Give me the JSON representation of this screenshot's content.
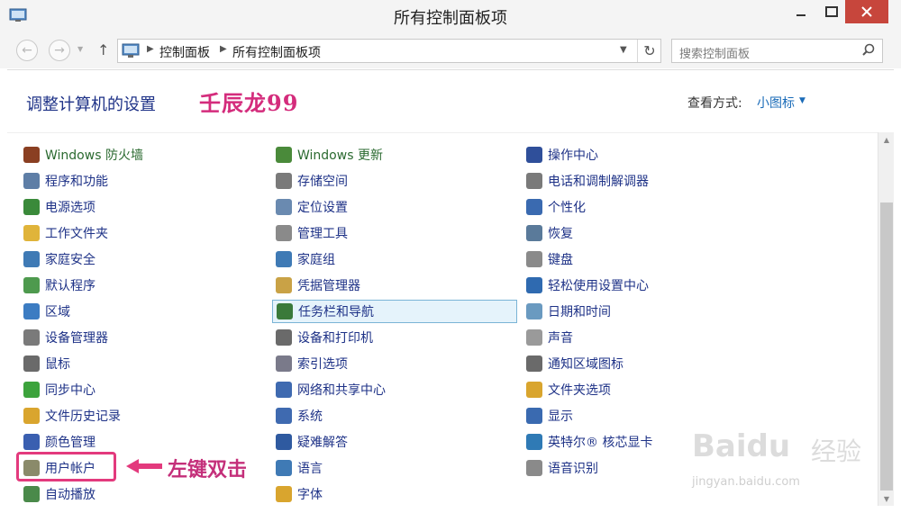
{
  "window": {
    "title": "所有控制面板项"
  },
  "address": {
    "crumbs": [
      "控制面板",
      "所有控制面板项"
    ]
  },
  "search": {
    "placeholder": "搜索控制面板"
  },
  "header": {
    "title": "调整计算机的设置",
    "watermark": "壬辰龙99",
    "view_label": "查看方式:",
    "view_value": "小图标"
  },
  "items": {
    "col1": [
      {
        "label": "Windows 防火墙",
        "icon": "firewall-icon",
        "color": "#8a3f22"
      },
      {
        "label": "程序和功能",
        "icon": "programs-icon",
        "color": "#5e7ea6"
      },
      {
        "label": "电源选项",
        "icon": "power-icon",
        "color": "#3a8a3a"
      },
      {
        "label": "工作文件夹",
        "icon": "work-folder-icon",
        "color": "#e0b43a"
      },
      {
        "label": "家庭安全",
        "icon": "family-safety-icon",
        "color": "#3f7ab5"
      },
      {
        "label": "默认程序",
        "icon": "default-programs-icon",
        "color": "#4e9a4e"
      },
      {
        "label": "区域",
        "icon": "region-icon",
        "color": "#3c7cc2"
      },
      {
        "label": "设备管理器",
        "icon": "device-manager-icon",
        "color": "#7a7a7a"
      },
      {
        "label": "鼠标",
        "icon": "mouse-icon",
        "color": "#6a6a6a"
      },
      {
        "label": "同步中心",
        "icon": "sync-center-icon",
        "color": "#3ca33c"
      },
      {
        "label": "文件历史记录",
        "icon": "file-history-icon",
        "color": "#d9a52e"
      },
      {
        "label": "颜色管理",
        "icon": "color-management-icon",
        "color": "#3a5fb0"
      },
      {
        "label": "用户帐户",
        "icon": "user-accounts-icon",
        "color": "#8a8a6a"
      },
      {
        "label": "自动播放",
        "icon": "autoplay-icon",
        "color": "#4a8a4a"
      }
    ],
    "col2": [
      {
        "label": "Windows 更新",
        "icon": "windows-update-icon",
        "color": "#4a8a3a"
      },
      {
        "label": "存储空间",
        "icon": "storage-spaces-icon",
        "color": "#7a7a7a"
      },
      {
        "label": "定位设置",
        "icon": "location-icon",
        "color": "#6a8ab0"
      },
      {
        "label": "管理工具",
        "icon": "admin-tools-icon",
        "color": "#8a8a8a"
      },
      {
        "label": "家庭组",
        "icon": "homegroup-icon",
        "color": "#3f7ab5"
      },
      {
        "label": "凭据管理器",
        "icon": "credential-manager-icon",
        "color": "#c9a246"
      },
      {
        "label": "任务栏和导航",
        "icon": "taskbar-icon",
        "color": "#3a7a3a"
      },
      {
        "label": "设备和打印机",
        "icon": "printer-icon",
        "color": "#6a6a6a"
      },
      {
        "label": "索引选项",
        "icon": "index-options-icon",
        "color": "#7a7a8a"
      },
      {
        "label": "网络和共享中心",
        "icon": "network-icon",
        "color": "#3f6ab0"
      },
      {
        "label": "系统",
        "icon": "system-icon",
        "color": "#3f6ab0"
      },
      {
        "label": "疑难解答",
        "icon": "troubleshooting-icon",
        "color": "#2f5aa0"
      },
      {
        "label": "语言",
        "icon": "language-icon",
        "color": "#3f7ab5"
      },
      {
        "label": "字体",
        "icon": "fonts-icon",
        "color": "#d9a52e"
      }
    ],
    "col3": [
      {
        "label": "操作中心",
        "icon": "action-center-icon",
        "color": "#2f4f9a"
      },
      {
        "label": "电话和调制解调器",
        "icon": "phone-modem-icon",
        "color": "#7a7a7a"
      },
      {
        "label": "个性化",
        "icon": "personalization-icon",
        "color": "#3a6ab0"
      },
      {
        "label": "恢复",
        "icon": "recovery-icon",
        "color": "#5a7a9a"
      },
      {
        "label": "键盘",
        "icon": "keyboard-icon",
        "color": "#8a8a8a"
      },
      {
        "label": "轻松使用设置中心",
        "icon": "ease-of-access-icon",
        "color": "#2f6ab0"
      },
      {
        "label": "日期和时间",
        "icon": "date-time-icon",
        "color": "#6a9ac0"
      },
      {
        "label": "声音",
        "icon": "sound-icon",
        "color": "#9a9a9a"
      },
      {
        "label": "通知区域图标",
        "icon": "notification-area-icon",
        "color": "#6a6a6a"
      },
      {
        "label": "文件夹选项",
        "icon": "folder-options-icon",
        "color": "#d9a52e"
      },
      {
        "label": "显示",
        "icon": "display-icon",
        "color": "#3a6ab0"
      },
      {
        "label": "英特尔® 核芯显卡",
        "icon": "intel-graphics-icon",
        "color": "#2f7ab5"
      },
      {
        "label": "语音识别",
        "icon": "speech-recognition-icon",
        "color": "#8a8a8a"
      }
    ]
  },
  "annotation": {
    "text": "左键双击"
  },
  "baidu": {
    "brand": "Baidu",
    "cn": "经验",
    "url": "jingyan.baidu.com"
  }
}
